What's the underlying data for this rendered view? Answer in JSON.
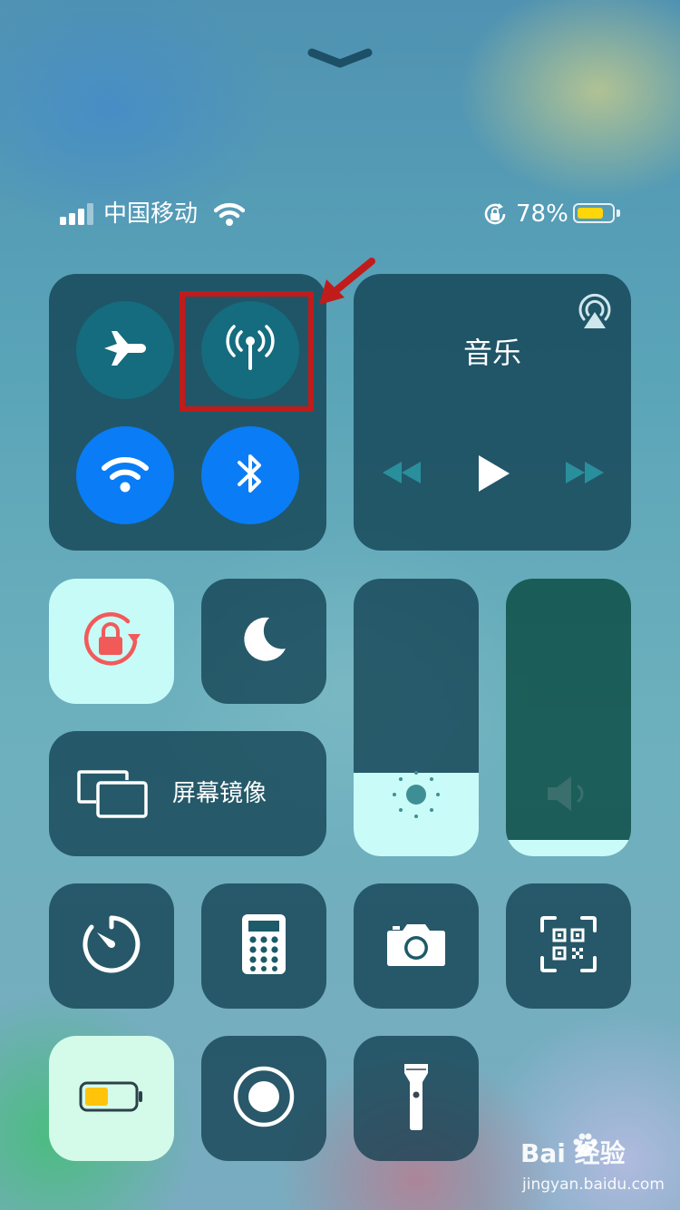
{
  "status": {
    "carrier": "中国移动",
    "battery_percent": "78%",
    "battery_level": 0.78,
    "battery_color": "#ffd60a"
  },
  "connectivity": {
    "airplane": {
      "icon": "airplane-icon",
      "enabled": false
    },
    "cellular": {
      "icon": "antenna-icon",
      "enabled": false,
      "highlight_color": "#c01c1c"
    },
    "wifi": {
      "icon": "wifi-icon",
      "enabled": true,
      "color": "#0a7cf6"
    },
    "bluetooth": {
      "icon": "bluetooth-icon",
      "enabled": true,
      "color": "#0a7cf6"
    }
  },
  "music": {
    "title": "音乐",
    "airplay_icon": "airplay-icon",
    "prev_icon": "rewind-icon",
    "play_icon": "play-icon",
    "next_icon": "fast-forward-icon"
  },
  "toggles": {
    "rotation_lock": {
      "icon": "rotation-lock-icon",
      "enabled": true,
      "color": "#f25a5a"
    },
    "do_not_disturb": {
      "icon": "moon-icon",
      "enabled": false
    }
  },
  "screen_mirroring": {
    "label": "屏幕镜像",
    "icon": "screen-mirroring-icon"
  },
  "sliders": {
    "brightness": {
      "level": 0.3,
      "icon": "sun-icon"
    },
    "volume": {
      "level": 0.06,
      "icon": "speaker-icon"
    }
  },
  "shortcuts": [
    {
      "name": "timer",
      "icon": "timer-icon"
    },
    {
      "name": "calculator",
      "icon": "calculator-icon"
    },
    {
      "name": "camera",
      "icon": "camera-icon"
    },
    {
      "name": "qr-scanner",
      "icon": "qr-code-icon"
    },
    {
      "name": "low-power-mode",
      "icon": "battery-icon"
    },
    {
      "name": "screen-recording",
      "icon": "record-icon"
    },
    {
      "name": "flashlight",
      "icon": "flashlight-icon"
    }
  ],
  "watermark": {
    "brand": "Bai 经验",
    "url": "jingyan.baidu.com"
  }
}
